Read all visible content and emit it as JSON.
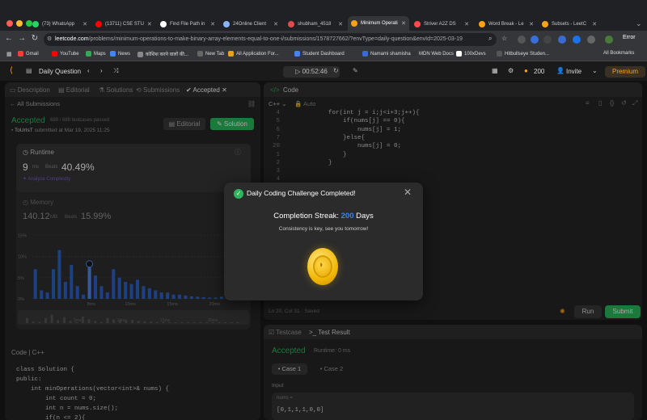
{
  "browser": {
    "tabs": [
      {
        "label": "(73) WhatsApp",
        "color": "#25d366"
      },
      {
        "label": "(13711) CSE STU",
        "color": "#ff0000"
      },
      {
        "label": "Find File Path in",
        "color": "#ffffff"
      },
      {
        "label": "24Online Client",
        "color": "#8ab4f8"
      },
      {
        "label": "shubham_4518",
        "color": "#e04b4b"
      },
      {
        "label": "Minimum Operati",
        "color": "#ffa116"
      },
      {
        "label": "Striver A2Z DS",
        "color": "#ff4b4b"
      },
      {
        "label": "Word Break - Le",
        "color": "#ffa116"
      },
      {
        "label": "Subsets - LeetC",
        "color": "#ffa116"
      }
    ],
    "url_host": "leetcode.com",
    "url_path": "/problems/minimum-operations-to-make-binary-array-elements-equal-to-one-i/submissions/1578727662/?envType=daily-question&envId=2025-03-19",
    "profile_label": "Error",
    "bookmarks": [
      "Gmail",
      "YouTube",
      "Maps",
      "News",
      "कोशिश करने वालों की...",
      "New Tab",
      "All Application For...",
      "Student Dashboard",
      "Namami shamisha...",
      "MDN Web Docs",
      "100xDevs",
      "Hitbullseye Studen..."
    ],
    "all_bookmarks": "All Bookmarks"
  },
  "lc": {
    "problem_list": "Daily Question",
    "timer": "00:52:46",
    "coins": "200",
    "invite": "Invite",
    "premium": "Premium"
  },
  "left": {
    "tabs": [
      "Description",
      "Editorial",
      "Solutions",
      "Submissions",
      "Accepted"
    ],
    "all_submissions": "All Submissions",
    "status": "Accepted",
    "testcases": "689 / 689 testcases passed",
    "user": "ToUrIsT",
    "submitted": "submitted at Mar 19, 2025 11:25",
    "editorial_btn": "Editorial",
    "solution_btn": "Solution",
    "runtime_label": "Runtime",
    "runtime_value": "9",
    "runtime_unit": "ms",
    "beats_label": "Beats",
    "runtime_beats": "40.49%",
    "analyze": "Analyze Complexity",
    "memory_label": "Memory",
    "memory_value": "140.12",
    "memory_unit": "MB",
    "memory_beats": "15.99%",
    "code_label": "Code",
    "code_lang": "C++",
    "code_lines": [
      "class Solution {",
      "public:",
      "    int minOperations(vector<int>& nums) {",
      "        int count = 0;",
      "        int n = nums.size();",
      "        if(n <= 2){"
    ]
  },
  "chart_data": {
    "type": "bar",
    "ylabel": "",
    "yticks": [
      "15%",
      "10%",
      "5%",
      "0%"
    ],
    "xticks": [
      "8ms",
      "10ms",
      "15ms",
      "20ms"
    ],
    "ylim": [
      0,
      16
    ],
    "values": [
      7,
      2,
      1.5,
      7,
      11.5,
      4,
      8,
      3,
      1,
      9,
      5.5,
      3,
      1.5,
      7,
      5,
      4,
      3.5,
      4.5,
      3,
      2.5,
      2,
      1.5,
      1.5,
      1,
      1,
      0.8,
      0.6,
      0.5,
      0.4,
      0.3,
      0.3,
      0.5,
      0.4,
      0.3,
      0.3
    ],
    "highlight_index": 9,
    "bar_color": "#2c63c6",
    "highlight_color": "#4f8cf0",
    "mini_xticks": [
      "5ms",
      "10ms",
      "15ms",
      "20ms"
    ]
  },
  "editor": {
    "header": "Code",
    "lang": "C++",
    "auto": "Auto",
    "lines": [
      {
        "num": "4",
        "text": "            for(int j = i;j<i+3;j++){"
      },
      {
        "num": "5",
        "text": "                if(nums[j] == 0){"
      },
      {
        "num": "6",
        "text": "                    nums[j] = 1;"
      },
      {
        "num": "7",
        "text": "                }else{"
      },
      {
        "num": "20",
        "text": "                    nums[j] = 0;"
      },
      {
        "num": "1",
        "text": "                }"
      },
      {
        "num": "2",
        "text": "            }"
      },
      {
        "num": "3",
        "text": ""
      },
      {
        "num": "4",
        "text": ""
      }
    ],
    "status": "Ln 20, Col 31",
    "saved": "Saved",
    "run": "Run",
    "submit": "Submit"
  },
  "testresult": {
    "testcase_tab": "Testcase",
    "result_tab": "Test Result",
    "status": "Accepted",
    "runtime": "Runtime: 0 ms",
    "case1": "Case 1",
    "case2": "Case 2",
    "input_label": "Input",
    "param": "nums =",
    "value": "[0,1,1,1,0,0]"
  },
  "modal": {
    "title": "Daily Coding Challenge Completed!",
    "streak_label": "Completion Streak:",
    "streak_num": "200",
    "streak_unit": "Days",
    "subtitle": "Consistency is key, see you tomorrow!",
    "accent": "#2db55d",
    "num_color": "#3b82f6"
  }
}
